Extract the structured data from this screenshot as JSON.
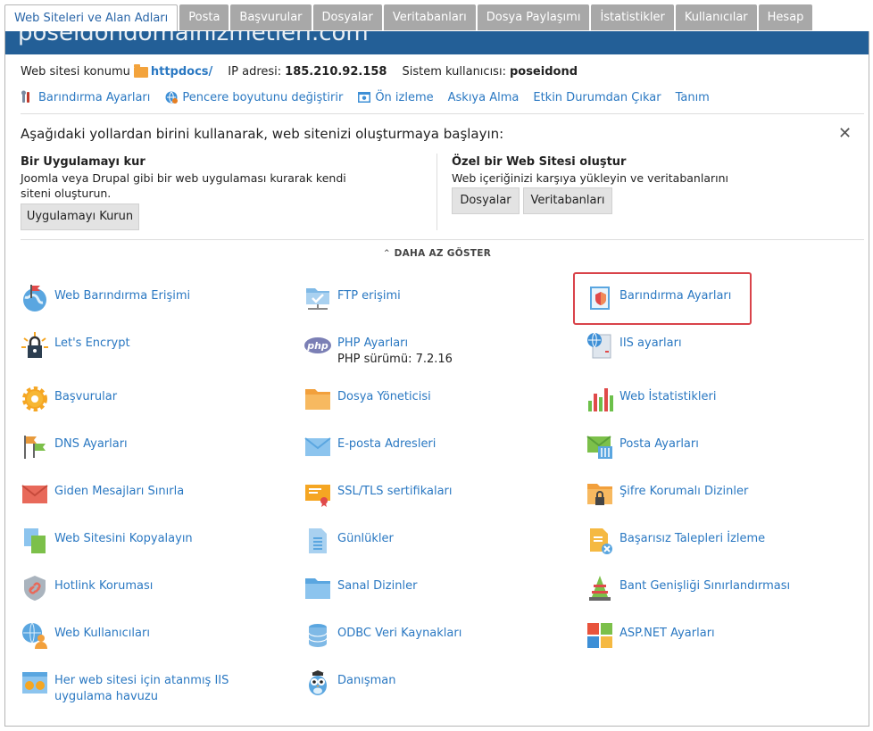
{
  "tabs": [
    {
      "label": "Web Siteleri ve Alan Adları",
      "active": true
    },
    {
      "label": "Posta"
    },
    {
      "label": "Başvurular"
    },
    {
      "label": "Dosyalar"
    },
    {
      "label": "Veritabanları"
    },
    {
      "label": "Dosya Paylaşımı"
    },
    {
      "label": "İstatistikler"
    },
    {
      "label": "Kullanıcılar"
    },
    {
      "label": "Hesap"
    }
  ],
  "header_title": "poseidondomainizmetleri.com",
  "info": {
    "location_label": "Web sitesi konumu",
    "location_value": "httpdocs/",
    "ip_label": "IP adresi:",
    "ip_value": "185.210.92.158",
    "user_label": "Sistem kullanıcısı:",
    "user_value": "poseidond"
  },
  "actions": [
    {
      "label": "Barındırma Ayarları",
      "icon": "tools-icon"
    },
    {
      "label": "Pencere boyutunu değiştirir",
      "icon": "globe-resize-icon"
    },
    {
      "label": "Ön izleme",
      "icon": "preview-icon"
    },
    {
      "label": "Askıya Alma"
    },
    {
      "label": "Etkin Durumdan Çıkar"
    },
    {
      "label": "Tanım"
    }
  ],
  "start": {
    "title": "Aşağıdaki yollardan birini kullanarak, web sitenizi oluşturmaya başlayın:",
    "app_title": "Bir Uygulamayı kur",
    "app_text": "Joomla veya Drupal gibi bir web uygulaması kurarak kendi siteni oluşturun.",
    "app_button": "Uygulamayı Kurun",
    "custom_title": "Özel bir Web Sitesi oluştur",
    "custom_text": "Web içeriğinizi karşıya yükleyin ve veritabanlarını ekleyin.",
    "files_button": "Dosyalar",
    "db_button": "Veritabanları",
    "show_less": "DAHA AZ GÖSTER"
  },
  "tools": [
    {
      "label": "Web Barındırma Erişimi",
      "icon": "globe-flag-icon"
    },
    {
      "label": "FTP erişimi",
      "icon": "ftp-folder-icon"
    },
    {
      "label": "Barındırma Ayarları",
      "icon": "hosting-settings-icon",
      "highlighted": true
    },
    {
      "label": "Let's Encrypt",
      "icon": "lock-sun-icon"
    },
    {
      "label": "PHP Ayarları",
      "sub": "PHP sürümü: 7.2.16",
      "icon": "php-icon"
    },
    {
      "label": "IIS ayarları",
      "icon": "iis-icon"
    },
    {
      "label": "Başvurular",
      "icon": "gear-icon"
    },
    {
      "label": "Dosya Yöneticisi",
      "icon": "folder-icon"
    },
    {
      "label": "Web İstatistikleri",
      "icon": "bar-chart-icon"
    },
    {
      "label": "DNS Ayarları",
      "icon": "dns-flags-icon"
    },
    {
      "label": "E-posta Adresleri",
      "icon": "envelope-icon"
    },
    {
      "label": "Posta Ayarları",
      "icon": "mail-settings-icon"
    },
    {
      "label": "Giden Mesajları Sınırla",
      "icon": "red-envelope-icon"
    },
    {
      "label": "SSL/TLS sertifikaları",
      "icon": "certificate-icon"
    },
    {
      "label": "Şifre Korumalı Dizinler",
      "icon": "locked-folder-icon"
    },
    {
      "label": "Web Sitesini Kopyalayın",
      "icon": "copy-pages-icon"
    },
    {
      "label": "Günlükler",
      "icon": "log-file-icon"
    },
    {
      "label": "Başarısız Talepleri İzleme",
      "icon": "failed-requests-icon"
    },
    {
      "label": "Hotlink Koruması",
      "icon": "hotlink-shield-icon"
    },
    {
      "label": "Sanal Dizinler",
      "icon": "blue-folder-icon"
    },
    {
      "label": "Bant Genişliği Sınırlandırması",
      "icon": "traffic-cone-icon"
    },
    {
      "label": "Web Kullanıcıları",
      "icon": "web-user-icon"
    },
    {
      "label": "ODBC Veri Kaynakları",
      "icon": "database-icon"
    },
    {
      "label": "ASP.NET Ayarları",
      "icon": "windows-grid-icon"
    },
    {
      "label": "Her web sitesi için atanmış IIS uygulama havuzu",
      "icon": "app-pool-icon"
    },
    {
      "label": "Danışman",
      "icon": "owl-icon"
    }
  ],
  "colors": {
    "accent": "#2a78c2",
    "header": "#235f97",
    "tab_inactive": "#a8a8a8",
    "highlight": "#d9434a"
  }
}
